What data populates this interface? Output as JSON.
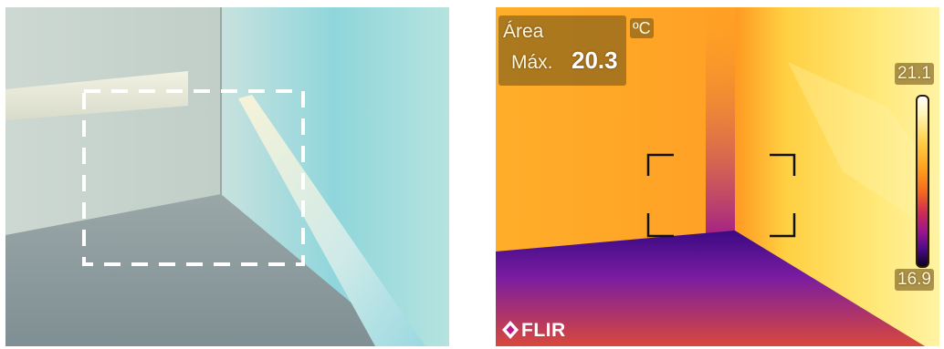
{
  "visible_photo": {
    "selection_marker": "dashed-rectangle"
  },
  "thermal_image": {
    "measurement_label": "Área",
    "max_label": "Máx.",
    "max_value": "20.3",
    "unit": "ºC",
    "scale_max": "21.1",
    "scale_min": "16.9",
    "brand": "FLIR",
    "palette": [
      "#ffffff",
      "#ffd24a",
      "#f46a1e",
      "#9a1490",
      "#0b0220"
    ]
  }
}
